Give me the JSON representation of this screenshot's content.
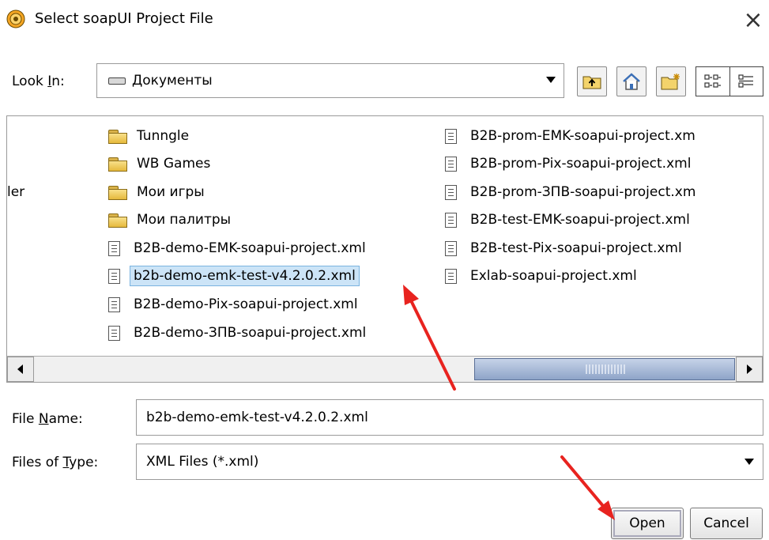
{
  "window": {
    "title": "Select soapUI Project File",
    "close_glyph": "×"
  },
  "lookin": {
    "label_pre": "Look ",
    "label_ul": "I",
    "label_post": "n:",
    "value": "Документы"
  },
  "toolbar": {
    "icons": [
      "up-folder-icon",
      "home-icon",
      "new-folder-icon",
      "list-view-icon",
      "details-view-icon"
    ]
  },
  "file_list": {
    "partial_left_text": "ler",
    "col1": [
      {
        "name": "Tunngle",
        "type": "folder"
      },
      {
        "name": "WB Games",
        "type": "folder"
      },
      {
        "name": "Мои игры",
        "type": "folder"
      },
      {
        "name": "Мои палитры",
        "type": "folder"
      },
      {
        "name": "B2B-demo-EMK-soapui-project.xml",
        "type": "file"
      },
      {
        "name": "b2b-demo-emk-test-v4.2.0.2.xml",
        "type": "file",
        "selected": true
      },
      {
        "name": "B2B-demo-Pix-soapui-project.xml",
        "type": "file"
      },
      {
        "name": "B2B-demo-ЗПВ-soapui-project.xml",
        "type": "file"
      }
    ],
    "col2": [
      {
        "name": "B2B-prom-EMK-soapui-project.xm",
        "type": "file"
      },
      {
        "name": "B2B-prom-Pix-soapui-project.xml",
        "type": "file"
      },
      {
        "name": "B2B-prom-ЗПВ-soapui-project.xm",
        "type": "file"
      },
      {
        "name": "B2B-test-EMK-soapui-project.xml",
        "type": "file"
      },
      {
        "name": "B2B-test-Pix-soapui-project.xml",
        "type": "file"
      },
      {
        "name": "Exlab-soapui-project.xml",
        "type": "file"
      }
    ]
  },
  "file_name": {
    "label_pre": "File ",
    "label_ul": "N",
    "label_post": "ame:",
    "value": "b2b-demo-emk-test-v4.2.0.2.xml"
  },
  "file_type": {
    "label_pre": "Files of ",
    "label_ul": "T",
    "label_post": "ype:",
    "value": "XML Files (*.xml)"
  },
  "buttons": {
    "open": "Open",
    "cancel": "Cancel"
  },
  "colors": {
    "selection": "#cce4f7",
    "annotation_arrow": "#e8231f",
    "scroll_thumb": "#8ea4c8"
  }
}
